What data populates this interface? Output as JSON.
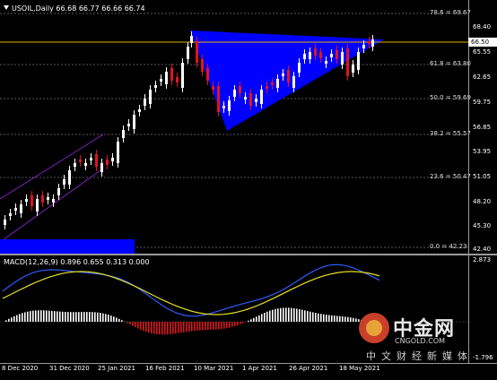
{
  "header": {
    "symbol_label": "USOIL,Daily  66.68 66.77 66.66 66.74"
  },
  "macd": {
    "label": "MACD(12,26,9) 0.896 0.655 0.313 0.000",
    "scale_top": "2.873",
    "scale_bottom": "-1.796"
  },
  "price_axis": {
    "ticks": [
      "68.40",
      "65.55",
      "62.65",
      "59.75",
      "56.85",
      "53.95",
      "51.05",
      "48.20",
      "45.30",
      "42.40"
    ],
    "current_price": "66.50"
  },
  "time_axis": {
    "ticks": [
      "8 Dec 2020",
      "31 Dec 2020",
      "25 Jan 2021",
      "16 Feb 2021",
      "10 Mar 2021",
      "1 Apr 2021",
      "26 Apr 2021",
      "18 May 2021"
    ]
  },
  "fibonacci": {
    "levels": [
      "78.6 = 69.67",
      "61.8 = 63.80",
      "50.0 = 59.69",
      "38.2 = 55.57",
      "23.6 = 50.47",
      "0.0 = 42.23"
    ]
  },
  "watermark": {
    "cn": "中金网",
    "en": "CNGOLD.COM",
    "sub": "中文财经新媒体"
  },
  "colors": {
    "background": "#000000",
    "bull_candle": "#ffffff",
    "bear_candle": "#e0141e",
    "triangle": "#0000ff",
    "channel": "#8020c0",
    "price_line": "#e0b000",
    "macd_line": "#2b5cff",
    "signal_line": "#e8e020"
  }
}
